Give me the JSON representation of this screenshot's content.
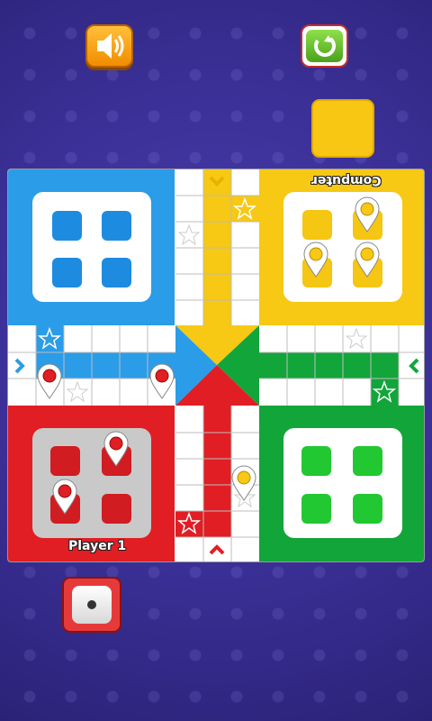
{
  "players": {
    "bottom_left": "Player 1",
    "top_right": "Computer"
  },
  "colors": {
    "blue": "#2b9ce8",
    "yellow": "#f7c814",
    "red": "#e01e24",
    "green": "#12a53a"
  },
  "icons": {
    "sound": "speaker-icon",
    "restart": "refresh-icon",
    "dice": "dice-icon"
  },
  "dice_value": 1
}
